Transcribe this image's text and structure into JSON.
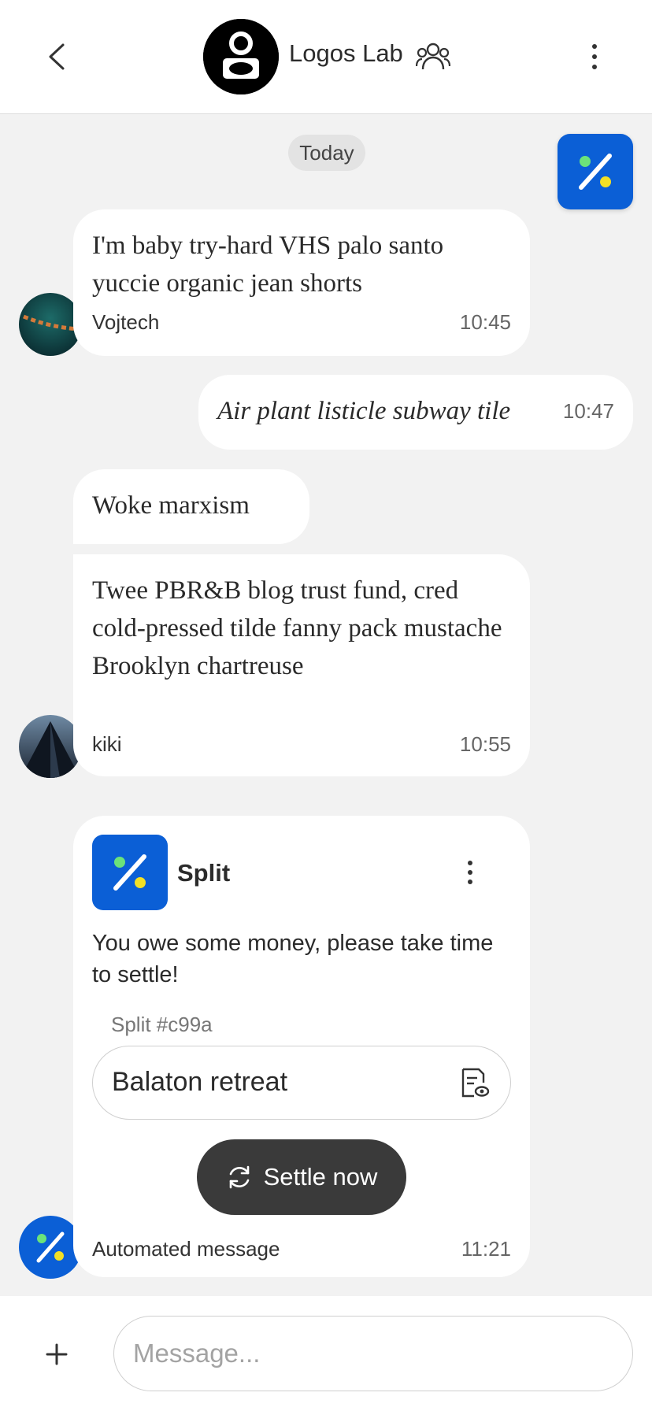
{
  "header": {
    "title": "Logos Lab",
    "back_icon": "chevron-left-icon",
    "group_icon": "people-icon",
    "menu_icon": "more-vertical-icon"
  },
  "date_separator": "Today",
  "split_app_icon": "split-percent-icon",
  "messages": [
    {
      "text": "I'm baby try-hard VHS palo santo yuccie organic jean shorts",
      "sender": "Vojtech",
      "time": "10:45",
      "direction": "incoming"
    },
    {
      "text": "Air plant listicle subway tile",
      "time": "10:47",
      "direction": "outgoing",
      "italic": true
    },
    {
      "text": "Woke marxism",
      "direction": "incoming"
    },
    {
      "text": "Twee PBR&B blog trust fund, cred cold-pressed tilde fanny pack mustache Brooklyn chartreuse",
      "sender": "kiki",
      "time": "10:55",
      "direction": "incoming"
    }
  ],
  "split_card": {
    "app_name": "Split",
    "body": "You owe some money, please take time to settle!",
    "split_id": "Split #c99a",
    "split_name": "Balaton retreat",
    "settle_label": "Settle now",
    "sender": "Automated message",
    "time": "11:21",
    "details_icon": "document-view-icon",
    "settle_icon": "sync-icon"
  },
  "composer": {
    "placeholder": "Message...",
    "add_icon": "plus-icon"
  },
  "colors": {
    "accent": "#0b5fd6",
    "settle_button": "#3a3a3a",
    "background": "#f2f2f2",
    "bubble": "#ffffff"
  }
}
